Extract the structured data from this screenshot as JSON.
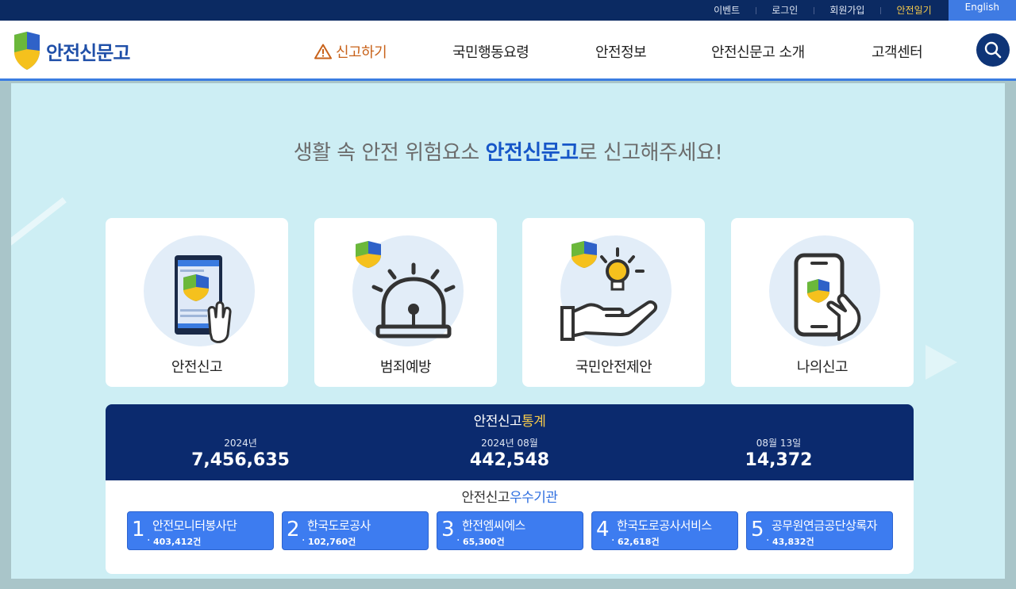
{
  "topbar": {
    "links": [
      "이벤트",
      "로그인",
      "회원가입",
      "안전일기"
    ],
    "english": "English"
  },
  "header": {
    "logo_text": "안전신문고",
    "nav": [
      "신고하기",
      "국민행동요령",
      "안전정보",
      "안전신문고 소개",
      "고객센터"
    ]
  },
  "hero": {
    "headline_pre": "생활 속 안전 위험요소 ",
    "headline_brand": "안전신문고",
    "headline_post": "로 신고해주세요!"
  },
  "cards": [
    {
      "label": "안전신고",
      "icon": "phone-report-icon"
    },
    {
      "label": "범죄예방",
      "icon": "siren-icon"
    },
    {
      "label": "국민안전제안",
      "icon": "idea-hand-icon"
    },
    {
      "label": "나의신고",
      "icon": "my-report-phone-icon"
    }
  ],
  "stats": {
    "title_pre": "안전신고",
    "title_hi": "통계",
    "items": [
      {
        "label": "2024년",
        "value": "7,456,635"
      },
      {
        "label": "2024년 08월",
        "value": "442,548"
      },
      {
        "label": "08월 13일",
        "value": "14,372"
      }
    ]
  },
  "agencies": {
    "title_pre": "안전신고",
    "title_hi": "우수기관",
    "items": [
      {
        "rank": "1",
        "name": "안전모니터봉사단",
        "count": "403,412건"
      },
      {
        "rank": "2",
        "name": "한국도로공사",
        "count": "102,760건"
      },
      {
        "rank": "3",
        "name": "한전엠씨에스",
        "count": "65,300건"
      },
      {
        "rank": "4",
        "name": "한국도로공사서비스",
        "count": "62,618건"
      },
      {
        "rank": "5",
        "name": "공무원연금공단상록자",
        "count": "43,832건"
      }
    ]
  },
  "colors": {
    "navy": "#0b2a6e",
    "accent_blue": "#3d7cf0",
    "highlight_yellow": "#f5c94a",
    "report_orange": "#c8621a",
    "hero_bg": "#cdeef4"
  }
}
